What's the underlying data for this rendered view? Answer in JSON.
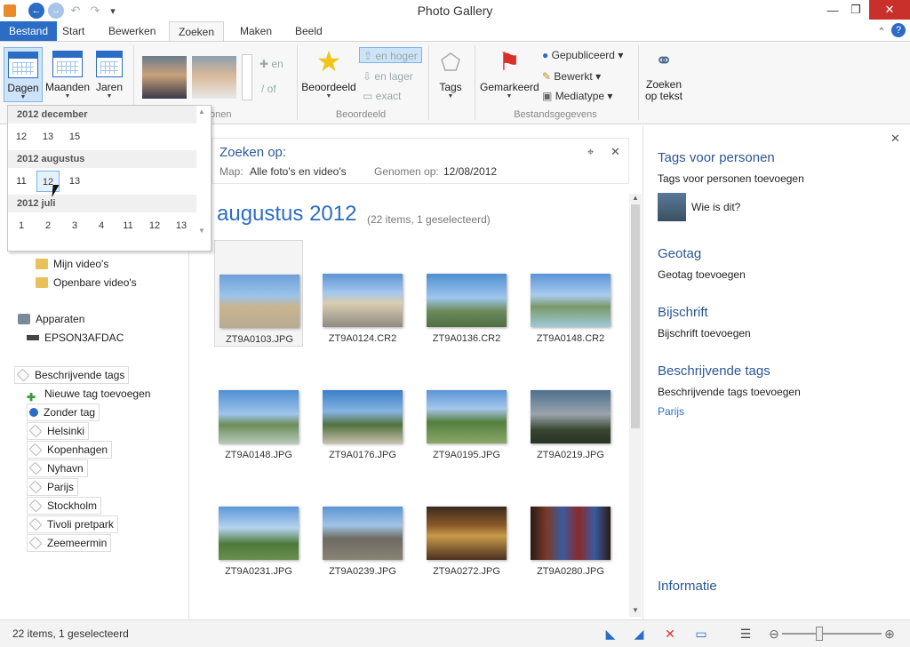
{
  "app": {
    "title": "Photo Gallery"
  },
  "quick_access": {
    "back": "←",
    "forward": "→",
    "undo": "↶",
    "redo": "↷",
    "customize": "▾"
  },
  "window": {
    "minimize": "—",
    "maximize": "❐",
    "close": "✕",
    "help": "?",
    "collapse": "⌃"
  },
  "tabs": [
    "Bestand",
    "Start",
    "Bewerken",
    "Zoeken",
    "Maken",
    "Beeld"
  ],
  "ribbon": {
    "days": "Dagen",
    "months": "Maanden",
    "years": "Jaren",
    "people_group": "onen",
    "and": "en",
    "or": "of",
    "rating": "Beoordeeld",
    "rating_group": "Beoordeeld",
    "higher": "en hoger",
    "lower": "en lager",
    "exact": "exact",
    "tags": "Tags",
    "flagged": "Gemarkeerd",
    "published": "Gepubliceerd",
    "edited": "Bewerkt",
    "media_type": "Mediatype",
    "file_group": "Bestandsgegevens",
    "search_text_1": "Zoeken",
    "search_text_2": "op tekst"
  },
  "dropdown": {
    "groups": [
      {
        "title": "2012 december",
        "days": [
          "12",
          "13",
          "15"
        ]
      },
      {
        "title": "2012 augustus",
        "days": [
          "11",
          "12",
          "13"
        ]
      },
      {
        "title": "2012 juli",
        "days": [
          "1",
          "2",
          "3",
          "4",
          "11",
          "12",
          "13"
        ]
      }
    ]
  },
  "nav": {
    "items": [
      {
        "label": "Mijn video's"
      },
      {
        "label": "Openbare video's"
      },
      {
        "label": "Apparaten"
      },
      {
        "label": "EPSON3AFDAC"
      },
      {
        "label": "Beschrijvende tags"
      },
      {
        "label": "Nieuwe tag toevoegen"
      },
      {
        "label": "Zonder tag"
      },
      {
        "label": "Helsinki"
      },
      {
        "label": "Kopenhagen"
      },
      {
        "label": "Nyhavn"
      },
      {
        "label": "Parijs"
      },
      {
        "label": "Stockholm"
      },
      {
        "label": "Tivoli pretpark"
      },
      {
        "label": "Zeemeermin"
      }
    ]
  },
  "search": {
    "title": "Zoeken op:",
    "map_label": "Map:",
    "map_value": "Alle foto's en video's",
    "date_label": "Genomen op:",
    "date_value": "12/08/2012",
    "pin": "⌖",
    "close": "✕"
  },
  "gallery": {
    "group_title": "augustus 2012",
    "group_count": "(22 items, 1 geselecteerd)",
    "photos": [
      {
        "name": "ZT9A0103.JPG",
        "selected": true
      },
      {
        "name": "ZT9A0124.CR2"
      },
      {
        "name": "ZT9A0136.CR2"
      },
      {
        "name": "ZT9A0148.CR2"
      },
      {
        "name": "ZT9A0148.JPG"
      },
      {
        "name": "ZT9A0176.JPG"
      },
      {
        "name": "ZT9A0195.JPG"
      },
      {
        "name": "ZT9A0219.JPG"
      },
      {
        "name": "ZT9A0231.JPG"
      },
      {
        "name": "ZT9A0239.JPG"
      },
      {
        "name": "ZT9A0272.JPG"
      },
      {
        "name": "ZT9A0280.JPG"
      }
    ]
  },
  "pane": {
    "close": "✕",
    "people_heading": "Tags voor personen",
    "people_add": "Tags voor personen toevoegen",
    "who": "Wie is dit?",
    "geotag_heading": "Geotag",
    "geotag_add": "Geotag toevoegen",
    "caption_heading": "Bijschrift",
    "caption_add": "Bijschrift toevoegen",
    "desc_heading": "Beschrijvende tags",
    "desc_add": "Beschrijvende tags toevoegen",
    "desc_tag": "Parijs",
    "info_heading": "Informatie"
  },
  "status": {
    "text": "22 items, 1 geselecteerd",
    "zoom_level": 0.37
  },
  "colors": {
    "accent": "#2b6cc4",
    "file_tab": "#2b6cc4",
    "heading": "#2b5797",
    "close_red": "#c9302c"
  }
}
